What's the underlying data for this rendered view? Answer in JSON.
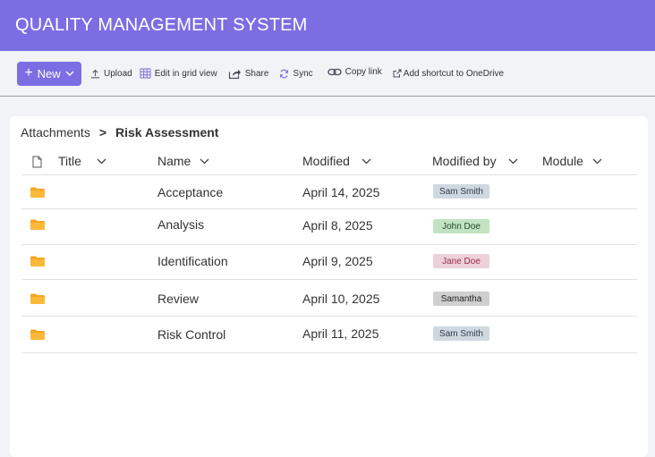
{
  "app": {
    "title": "QUALITY MANAGEMENT SYSTEM"
  },
  "toolbar": {
    "new_label": "New",
    "upload_label": "Upload",
    "grid_label": "Edit in grid view",
    "share_label": "Share",
    "sync_label": "Sync",
    "copy_link_label": "Copy link",
    "shortcut_label": "Add shortcut to OneDrive"
  },
  "breadcrumb": {
    "root": "Attachments",
    "separator": ">",
    "current": "Risk Assessment"
  },
  "table": {
    "headers": {
      "title": "Title",
      "name": "Name",
      "modified": "Modified",
      "modified_by": "Modified by",
      "module": "Module"
    },
    "rows": [
      {
        "name": "Acceptance",
        "modified": "April 14, 2025",
        "modified_by": "Sam Smith",
        "module": ""
      },
      {
        "name": "Analysis",
        "modified": "April 8, 2025",
        "modified_by": "John Doe",
        "module": ""
      },
      {
        "name": "Identification",
        "modified": "April 9, 2025",
        "modified_by": "Jane Doe",
        "module": ""
      },
      {
        "name": "Review",
        "modified": "April 10, 2025",
        "modified_by": "Samantha",
        "module": ""
      },
      {
        "name": "Risk Control",
        "modified": "April 11, 2025",
        "modified_by": "Sam Smith",
        "module": ""
      }
    ]
  },
  "colors": {
    "brand": "#7b6ee3",
    "folder": "#f5a623",
    "badge_sam_smith": "#cfd8e1",
    "badge_john_doe": "#c2e3c2",
    "badge_jane_doe": "#ecd2d8",
    "badge_samantha": "#cfcfcf"
  }
}
